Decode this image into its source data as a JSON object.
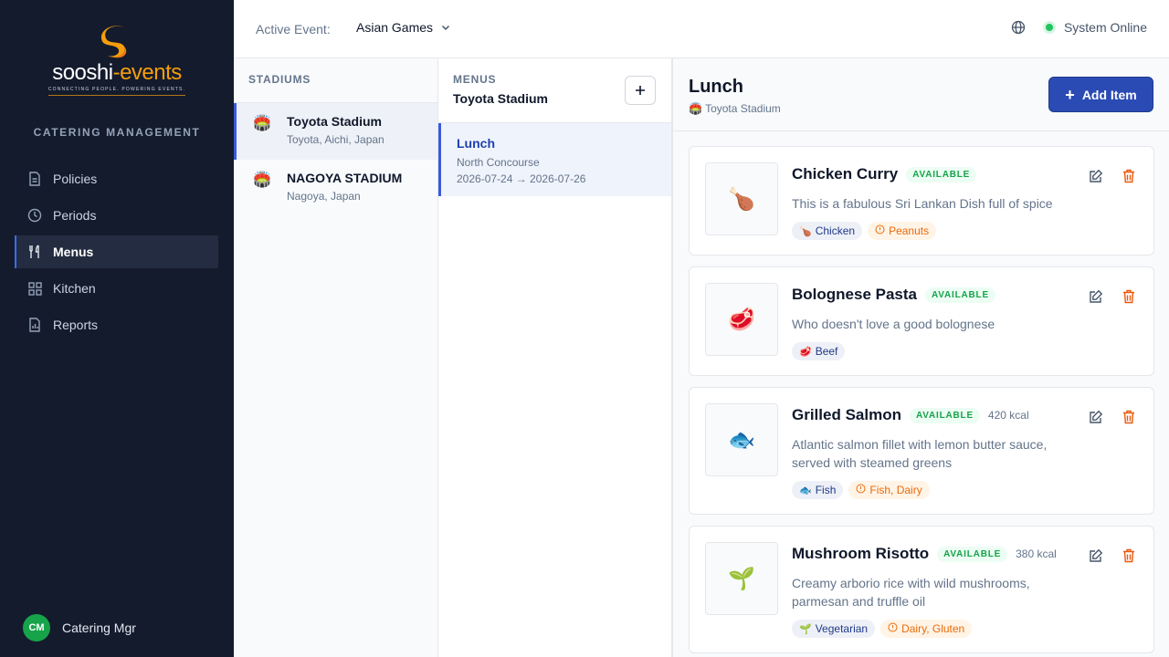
{
  "brand": {
    "name_primary": "sooshi",
    "name_accent": "-events",
    "tagline": "CONNECTING PEOPLE. POWERING EVENTS.",
    "accent_color": "#f59e0b"
  },
  "sidebar": {
    "section_label": "CATERING MANAGEMENT",
    "items": [
      {
        "label": "Policies",
        "icon": "document-icon"
      },
      {
        "label": "Periods",
        "icon": "clock-icon"
      },
      {
        "label": "Menus",
        "icon": "utensils-icon",
        "active": true
      },
      {
        "label": "Kitchen",
        "icon": "grid-icon"
      },
      {
        "label": "Reports",
        "icon": "report-icon"
      }
    ],
    "user": {
      "initials": "CM",
      "name": "Catering Mgr"
    }
  },
  "topbar": {
    "event_label": "Active Event:",
    "event_value": "Asian Games",
    "status": "System Online"
  },
  "stadiums": {
    "header": "STADIUMS",
    "items": [
      {
        "name": "Toyota Stadium",
        "location": "Toyota, Aichi, Japan",
        "active": true
      },
      {
        "name": "NAGOYA STADIUM",
        "location": "Nagoya, Japan"
      }
    ]
  },
  "menus": {
    "header": "MENUS",
    "stadium": "Toyota Stadium",
    "items": [
      {
        "name": "Lunch",
        "location": "North Concourse",
        "dates": "2026-07-24 → 2026-07-26"
      }
    ]
  },
  "detail": {
    "title": "Lunch",
    "stadium": "Toyota Stadium",
    "add_label": "Add Item",
    "items": [
      {
        "name": "Chicken Curry",
        "status": "AVAILABLE",
        "kcal": "",
        "description": "This is a fabulous Sri Lankan Dish full of spice",
        "emoji": "🍗",
        "category": "Chicken",
        "allergens": "Peanuts"
      },
      {
        "name": "Bolognese Pasta",
        "status": "AVAILABLE",
        "kcal": "",
        "description": "Who doesn't love a good bolognese",
        "emoji": "🥩",
        "category": "Beef",
        "allergens": ""
      },
      {
        "name": "Grilled Salmon",
        "status": "AVAILABLE",
        "kcal": "420 kcal",
        "description": "Atlantic salmon fillet with lemon butter sauce, served with steamed greens",
        "emoji": "🐟",
        "category": "Fish",
        "allergens": "Fish, Dairy"
      },
      {
        "name": "Mushroom Risotto",
        "status": "AVAILABLE",
        "kcal": "380 kcal",
        "description": "Creamy arborio rice with wild mushrooms, parmesan and truffle oil",
        "emoji": "🌱",
        "category": "Vegetarian",
        "allergens": "Dairy, Gluten"
      }
    ]
  }
}
